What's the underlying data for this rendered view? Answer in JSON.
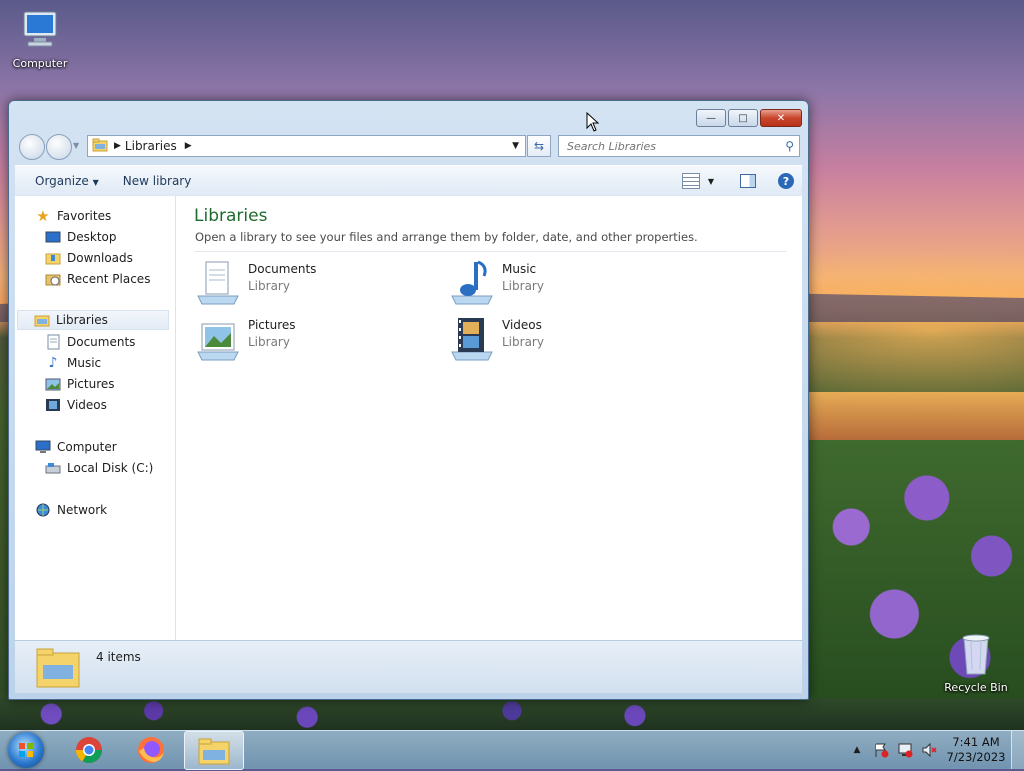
{
  "desktop": {
    "icons": [
      {
        "label": "Computer"
      },
      {
        "label": "Recycle Bin"
      }
    ]
  },
  "window": {
    "address": {
      "crumbs": [
        "Libraries"
      ]
    },
    "search": {
      "placeholder": "Search Libraries"
    },
    "toolbar": {
      "organize": "Organize",
      "new_library": "New library"
    },
    "nav": {
      "favorites": {
        "label": "Favorites",
        "items": [
          "Desktop",
          "Downloads",
          "Recent Places"
        ]
      },
      "libraries": {
        "label": "Libraries",
        "items": [
          "Documents",
          "Music",
          "Pictures",
          "Videos"
        ]
      },
      "computer": {
        "label": "Computer",
        "items": [
          "Local Disk (C:)"
        ]
      },
      "network": {
        "label": "Network"
      }
    },
    "main": {
      "title": "Libraries",
      "subtitle": "Open a library to see your files and arrange them by folder, date, and other properties.",
      "libraries": [
        {
          "name": "Documents",
          "kind": "Library"
        },
        {
          "name": "Music",
          "kind": "Library"
        },
        {
          "name": "Pictures",
          "kind": "Library"
        },
        {
          "name": "Videos",
          "kind": "Library"
        }
      ]
    },
    "status": {
      "count": "4 items"
    }
  },
  "taskbar": {
    "apps": [
      "chrome-icon",
      "firefox-icon",
      "explorer-icon"
    ],
    "clock": {
      "time": "7:41 AM",
      "date": "7/23/2023"
    }
  },
  "colors": {
    "title_green": "#1e6b2e",
    "selection": "#e3ebf5"
  }
}
